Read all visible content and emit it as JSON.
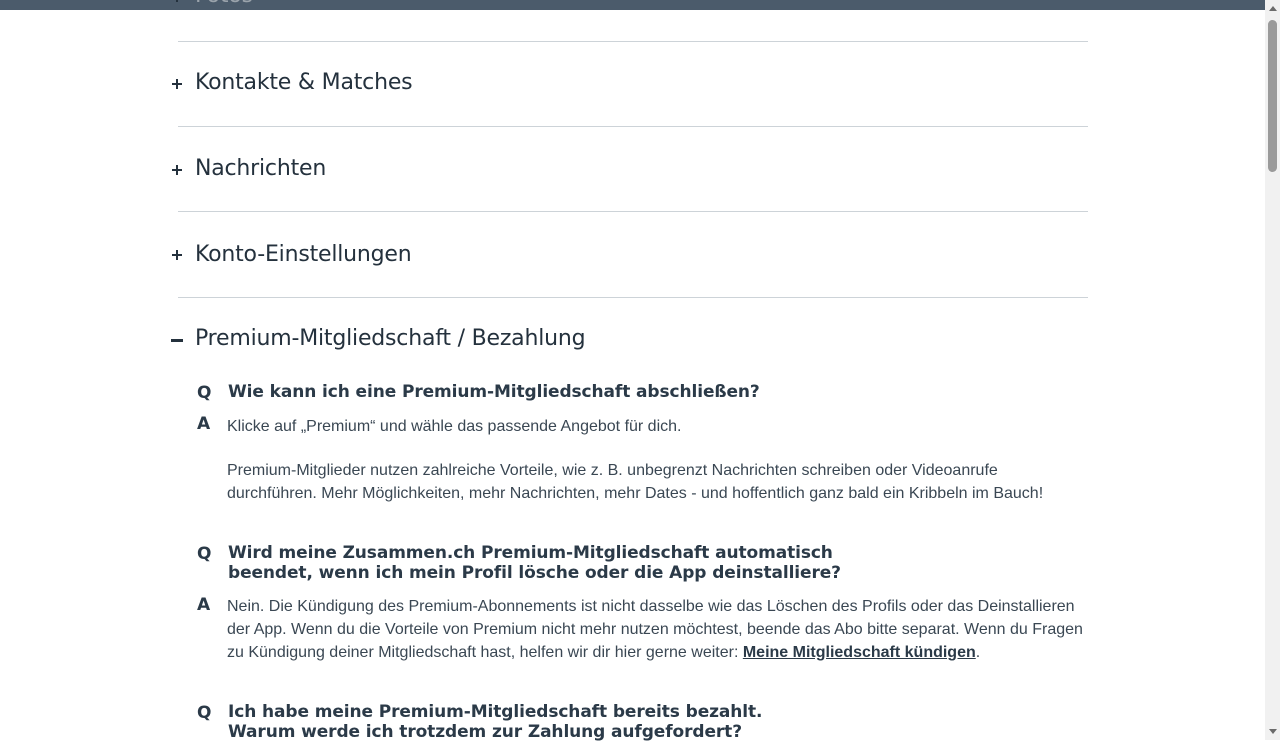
{
  "sections": [
    {
      "title": "Fotos",
      "state": "collapsed"
    },
    {
      "title": "Kontakte & Matches",
      "state": "collapsed"
    },
    {
      "title": "Nachrichten",
      "state": "collapsed"
    },
    {
      "title": "Konto-Einstellungen",
      "state": "collapsed"
    },
    {
      "title": "Premium-Mitgliedschaft / Bezahlung",
      "state": "expanded"
    }
  ],
  "qa_marks": {
    "q": "Q",
    "a": "A"
  },
  "faq": [
    {
      "q_line1": "Wie kann ich eine Premium-Mitgliedschaft abschließen?",
      "a_p1": "Klicke auf „Premium“ und wähle das passende Angebot für dich.",
      "a_p2_line1": "Premium-Mitglieder nutzen zahlreiche Vorteile, wie z. B. unbegrenzt Nachrichten schreiben oder Videoanrufe",
      "a_p2_line2": "durchführen. Mehr Möglichkeiten, mehr Nachrichten, mehr Dates - und hoffentlich ganz bald ein Kribbeln im Bauch!"
    },
    {
      "q_line1": "Wird meine Zusammen.ch Premium-Mitgliedschaft automatisch",
      "q_line2": "beendet, wenn ich mein Profil lösche oder die App deinstalliere?",
      "a_line1": "Nein. Die Kündigung des Premium-Abonnements ist nicht dasselbe wie das Löschen des Profils oder das Deinstallieren",
      "a_line2": "der App. Wenn du die Vorteile von Premium nicht mehr nutzen möchtest, beende das Abo bitte separat. Wenn du Fragen",
      "a_line3_prefix": "zu Kündigung deiner Mitgliedschaft hast, helfen wir dir hier gerne weiter: ",
      "a_link": "Meine Mitgliedschaft kündigen",
      "a_line3_suffix": "."
    },
    {
      "q_line1": "Ich habe meine Premium-Mitgliedschaft bereits bezahlt.",
      "q_line2": "Warum werde ich trotzdem zur Zahlung aufgefordert?"
    }
  ],
  "colors": {
    "topbar": "#4b5b6b",
    "text": "#2b3a48",
    "divider": "#cdd3d8"
  }
}
